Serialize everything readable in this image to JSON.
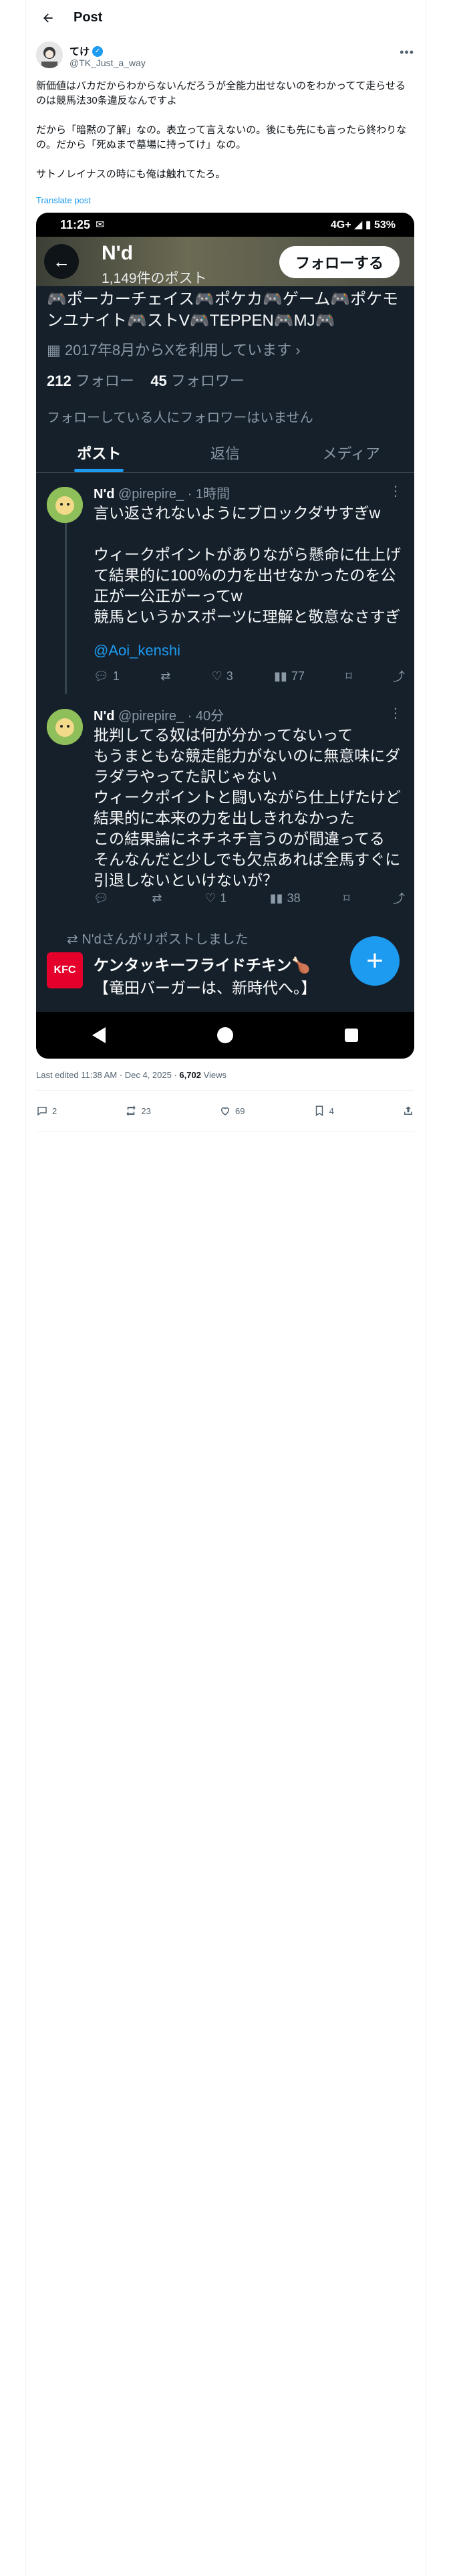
{
  "header": {
    "title": "Post",
    "back_icon": "arrow-left-icon"
  },
  "author": {
    "name": "てけ",
    "handle": "@TK_Just_a_way",
    "verified": true
  },
  "post": {
    "text": "新価値はバカだからわからないんだろうが全能力出せないのをわかってて走らせるのは競馬法30条違反なんですよ\n\nだから「暗黙の了解」なの。表立って言えないの。後にも先にも言ったら終わりなの。だから「死ぬまで墓場に持ってけ」なの。\n\nサトノレイナスの時にも俺は触れてたろ。",
    "translate_label": "Translate post"
  },
  "screenshot": {
    "status": {
      "time": "11:25",
      "right": "4G+ ◢ ▮ 53%"
    },
    "profile": {
      "name": "N'd",
      "post_count": "1,149件のポスト",
      "follow_label": "フォローする",
      "bio": "🎮ポーカーチェイス🎮ポケカ🎮ゲーム🎮ポケモンユナイト🎮ストV🎮TEPPEN🎮MJ🎮",
      "joined": "2017年8月からXを利用しています",
      "following_count": "212",
      "following_label": "フォロー",
      "followers_count": "45",
      "followers_label": "フォロワー",
      "no_mutual": "フォローしている人にフォロワーはいません"
    },
    "tabs": [
      {
        "label": "ポスト",
        "active": true
      },
      {
        "label": "返信",
        "active": false
      },
      {
        "label": "メディア",
        "active": false
      }
    ],
    "tweets": [
      {
        "name": "N'd",
        "handle": "@pirepire_",
        "time": "· 1時間",
        "text": "言い返されないようにブロックダサすぎw\n\nウィークポイントがありながら懸命に仕上げて結果的に100％の力を出せなかったのを公正が一公正がーってw\n競馬というかスポーツに理解と敬意なさすぎ",
        "mention": "@Aoi_kenshi",
        "replies": "1",
        "retweets": "",
        "likes": "3",
        "views": "77"
      },
      {
        "name": "N'd",
        "handle": "@pirepire_",
        "time": "· 40分",
        "text": "批判してる奴は何が分かってないって\nもうまともな競走能力がないのに無意味にダラダラやってた訳じゃない\nウィークポイントと闘いながら仕上げたけど結果的に本来の力を出しきれなかった\nこの結果論にネチネチ言うのが間違ってる\nそんなんだと少しでも欠点あれば全馬すぐに引退しないといけないが？",
        "replies": "",
        "retweets": "",
        "likes": "1",
        "views": "38"
      }
    ],
    "repost_note": "N'dさんがリポストしました",
    "kfc": {
      "logo": "KFC",
      "name": "ケンタッキーフライドチキン🍗",
      "text": "【竜田バーガーは、新時代へ。】"
    },
    "fab": "+"
  },
  "footer": {
    "edited": "Last edited 11:38 AM · Dec 4, 2025 · ",
    "views_count": "6,702",
    "views_label": "Views",
    "replies": "2",
    "reposts": "23",
    "likes": "69",
    "bookmarks": "4"
  }
}
